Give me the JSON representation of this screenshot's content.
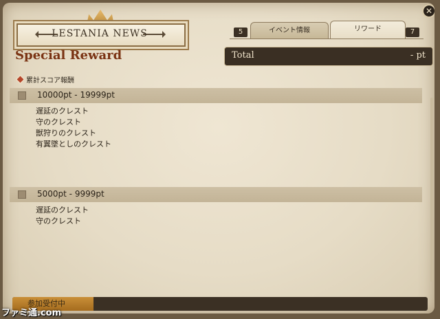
{
  "banner": {
    "title": "LESTANIA NEWS"
  },
  "page_heading": "Special Reward",
  "tabs": [
    {
      "badge": "5",
      "label": "イベント情報",
      "active": false
    },
    {
      "badge": "7",
      "label": "リワード",
      "active": true
    }
  ],
  "total": {
    "label": "Total",
    "value": "- pt"
  },
  "section_title": "累計スコア報酬",
  "rewards": [
    {
      "range": "10000pt  - 19999pt",
      "items": [
        "遅延のクレスト",
        "守のクレスト",
        "獣狩りのクレスト",
        "有翼墜としのクレスト"
      ]
    },
    {
      "range": "5000pt  - 9999pt",
      "items": [
        "遅延のクレスト",
        "守のクレスト"
      ]
    }
  ],
  "footer": {
    "status": "参加受付中"
  },
  "close_icon": "close-icon",
  "watermark": "ファミ通.com"
}
